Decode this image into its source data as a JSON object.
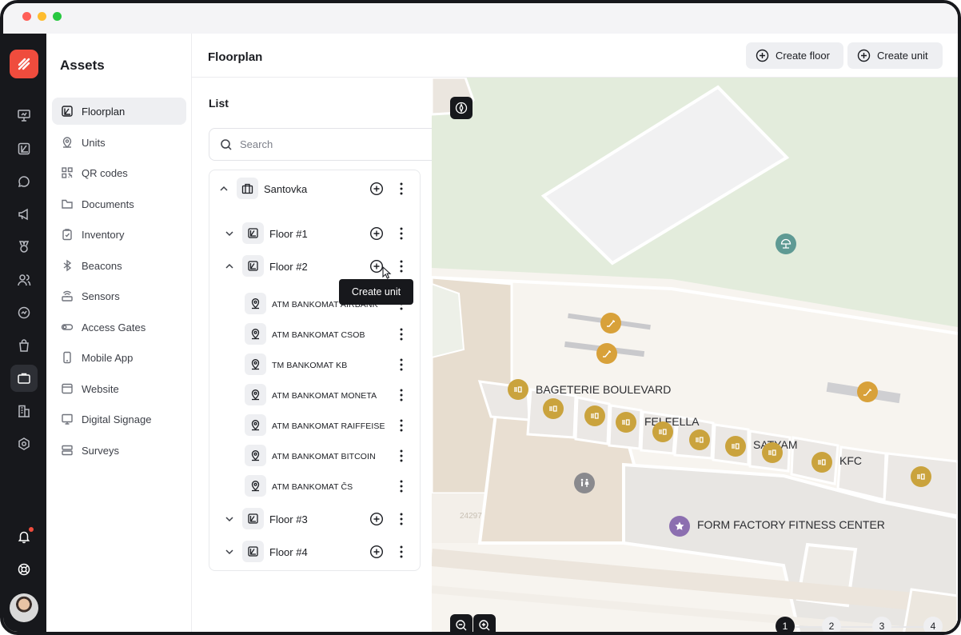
{
  "sidebar": {
    "title": "Assets",
    "items": [
      {
        "label": "Floorplan",
        "icon": "floorplan-icon",
        "active": true
      },
      {
        "label": "Units",
        "icon": "map-pin-icon"
      },
      {
        "label": "QR codes",
        "icon": "qr-code-icon"
      },
      {
        "label": "Documents",
        "icon": "folder-icon"
      },
      {
        "label": "Inventory",
        "icon": "clipboard-icon"
      },
      {
        "label": "Beacons",
        "icon": "bluetooth-icon"
      },
      {
        "label": "Sensors",
        "icon": "sensor-icon"
      },
      {
        "label": "Access Gates",
        "icon": "toggle-icon"
      },
      {
        "label": "Mobile App",
        "icon": "phone-icon"
      },
      {
        "label": "Website",
        "icon": "browser-icon"
      },
      {
        "label": "Digital Signage",
        "icon": "monitor-icon"
      },
      {
        "label": "Surveys",
        "icon": "survey-icon"
      }
    ]
  },
  "header": {
    "title": "Floorplan",
    "create_floor": "Create floor",
    "create_unit": "Create unit"
  },
  "list": {
    "title": "List",
    "search_placeholder": "Search",
    "building": "Santovka",
    "floors": [
      "Floor #1",
      "Floor #2",
      "Floor #3",
      "Floor #4"
    ],
    "units": [
      "ATM BANKOMAT AIRBANK",
      "ATM BANKOMAT CSOB",
      "TM BANKOMAT KB",
      "ATM BANKOMAT MONETA",
      "ATM BANKOMAT RAIFFEISE",
      "ATM BANKOMAT BITCOIN",
      "ATM BANKOMAT ČS"
    ],
    "tooltip": "Create unit"
  },
  "map": {
    "labels": [
      "BAGETERIE BOULEVARD",
      "FELFELLA",
      "SATYAM",
      "KFC",
      "FORM FACTORY FITNESS CENTER"
    ],
    "floor_pages": [
      "1",
      "2",
      "3",
      "4"
    ],
    "active_floor_page": "1",
    "colors": {
      "park": "#e3ecdc",
      "poi_food": "#caa33d",
      "poi_escalator": "#d8a13a",
      "poi_fitness": "#8c6fb0",
      "poi_restroom": "#8a8a8e",
      "poi_teal": "#5f9a94"
    }
  },
  "rail": {
    "icons": [
      "presentation-icon",
      "floorplan-icon",
      "chat-icon",
      "megaphone-icon",
      "medal-icon",
      "users-icon",
      "analytics-icon",
      "shopping-bag-icon",
      "briefcase-icon",
      "building-icon",
      "settings-icon",
      "bell-icon",
      "support-icon"
    ]
  }
}
